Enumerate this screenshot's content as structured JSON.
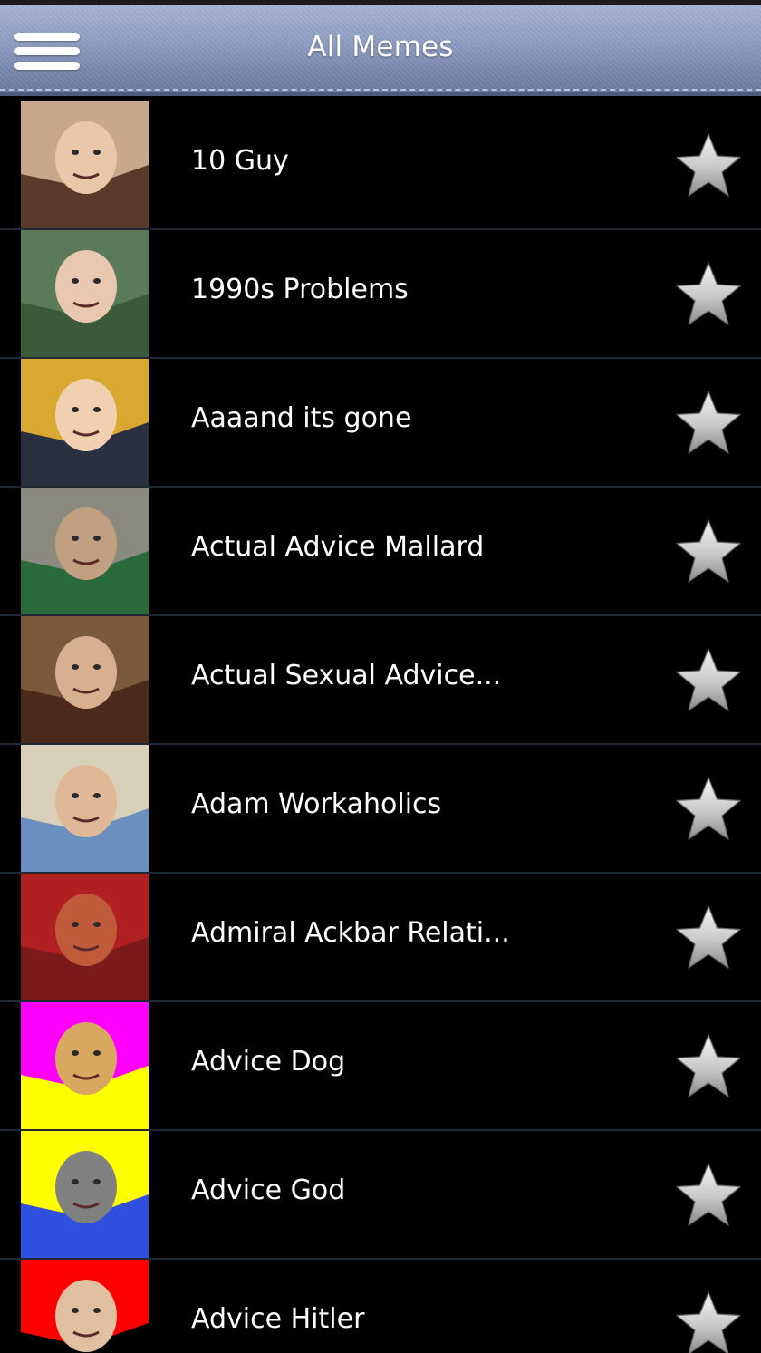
{
  "header": {
    "title": "All Memes",
    "menu_icon": "hamburger-menu-icon"
  },
  "list": {
    "items": [
      {
        "label": "10 Guy",
        "thumb_colors": [
          "#c8a88a",
          "#5a3a2a",
          "#e8c8a8"
        ],
        "favorite": false
      },
      {
        "label": "1990s Problems",
        "thumb_colors": [
          "#5a7a5a",
          "#3a5a3a",
          "#e8c8b0"
        ],
        "favorite": false
      },
      {
        "label": "Aaaand its gone",
        "thumb_colors": [
          "#d8a830",
          "#2a3040",
          "#f0d0b0"
        ],
        "favorite": false
      },
      {
        "label": "Actual Advice Mallard",
        "thumb_colors": [
          "#8a8a80",
          "#2a6a3a",
          "#c0a080"
        ],
        "favorite": false
      },
      {
        "label": "Actual Sexual Advice...",
        "thumb_colors": [
          "#7a5a3a",
          "#4a2a1a",
          "#d8b090"
        ],
        "favorite": false
      },
      {
        "label": "Adam Workaholics",
        "thumb_colors": [
          "#d8d0b8",
          "#6a90c0",
          "#e0b898"
        ],
        "favorite": false
      },
      {
        "label": "Admiral Ackbar Relati...",
        "thumb_colors": [
          "#b02020",
          "#7a1a1a",
          "#c05a3a"
        ],
        "favorite": false
      },
      {
        "label": "Advice Dog",
        "thumb_colors": [
          "#ff00ff",
          "#ffff00",
          "#d8a860"
        ],
        "favorite": false
      },
      {
        "label": "Advice God",
        "thumb_colors": [
          "#ffff00",
          "#3050e0",
          "#808080"
        ],
        "favorite": false
      },
      {
        "label": "Advice Hitler",
        "thumb_colors": [
          "#ff0000",
          "#000000",
          "#e0c0a0"
        ],
        "favorite": false
      }
    ],
    "star_icon": "star-icon"
  },
  "colors": {
    "header_gradient_top": "#a7b5d2",
    "header_gradient_bottom": "#68789c",
    "row_divider": "#202833",
    "star_fill": "#d8d8d8"
  }
}
